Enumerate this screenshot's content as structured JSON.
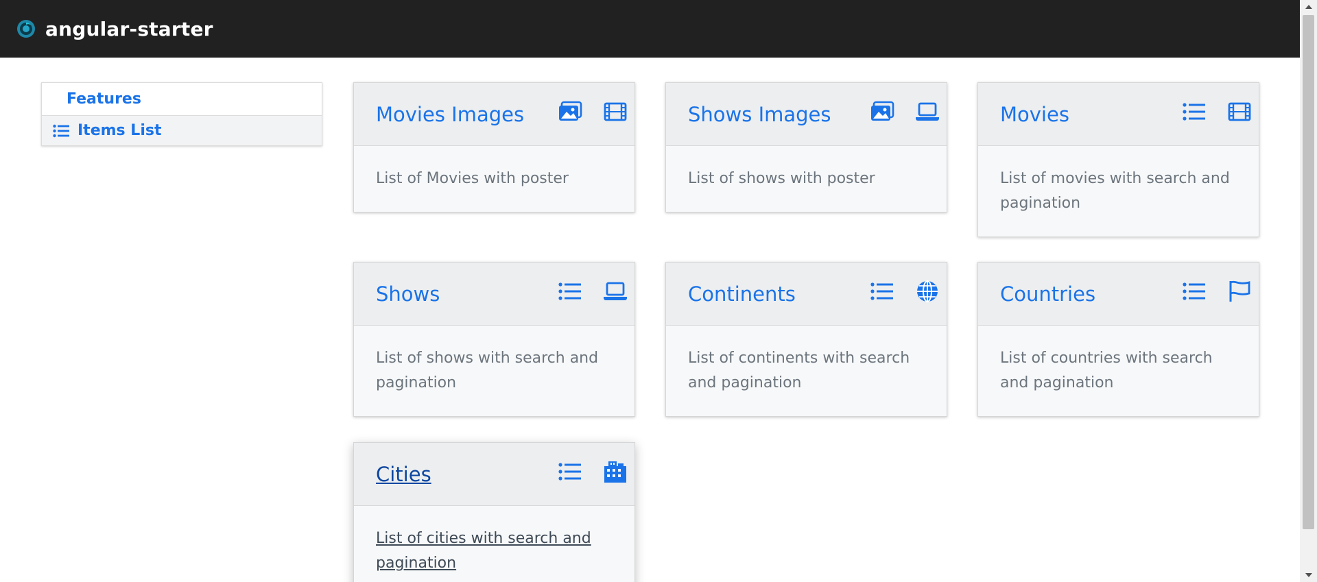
{
  "navbar": {
    "title": "angular-starter"
  },
  "sidebar": {
    "header": "Features",
    "items": [
      {
        "label": "Items List",
        "icon": "list-icon"
      }
    ]
  },
  "cards": [
    {
      "title": "Movies Images",
      "description": "List of Movies with poster",
      "icons": [
        "image-icon",
        "film-icon"
      ]
    },
    {
      "title": "Shows Images",
      "description": "List of shows with poster",
      "icons": [
        "image-icon",
        "laptop-icon"
      ]
    },
    {
      "title": "Movies",
      "description": "List of movies with search and pagination",
      "icons": [
        "list-icon",
        "film-icon"
      ]
    },
    {
      "title": "Shows",
      "description": "List of shows with search and pagination",
      "icons": [
        "list-icon",
        "laptop-icon"
      ]
    },
    {
      "title": "Continents",
      "description": "List of continents with search and pagination",
      "icons": [
        "list-icon",
        "globe-icon"
      ]
    },
    {
      "title": "Countries",
      "description": "List of countries with search and pagination",
      "icons": [
        "list-icon",
        "flag-icon"
      ]
    },
    {
      "title": "Cities",
      "description": "List of cities with search and pagination",
      "icons": [
        "list-icon",
        "building-icon"
      ]
    }
  ],
  "colors": {
    "accent": "#1a73e8",
    "navbar": "#212121",
    "card_bg": "#f7f8f9",
    "card_header_bg": "#eceef0"
  }
}
